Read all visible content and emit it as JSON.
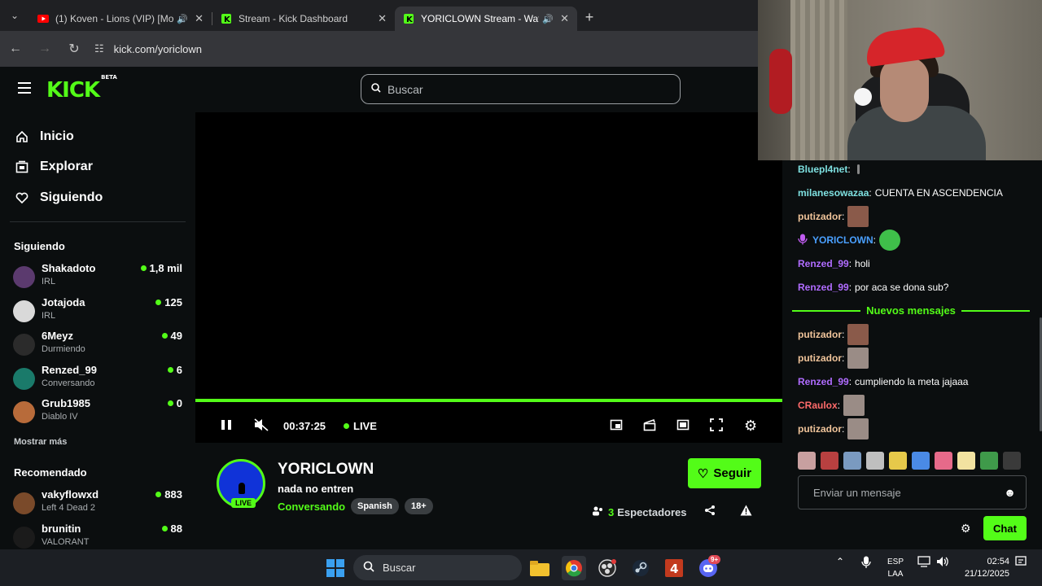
{
  "browser": {
    "tabs": [
      {
        "title": "(1) Koven - Lions (VIP) [Mon",
        "favicon": "youtube-icon",
        "speaker": "🔊",
        "close": "✕"
      },
      {
        "title": "Stream - Kick Dashboard",
        "favicon": "kick-icon",
        "close": "✕"
      },
      {
        "title": "YORICLOWN Stream - Watc",
        "favicon": "kick-icon",
        "speaker": "🔊",
        "close": "✕"
      }
    ],
    "new_tab": "+",
    "url": "kick.com/yoriclown"
  },
  "kick": {
    "logo": "KICK",
    "logo_badge": "BETA",
    "search_placeholder": "Buscar",
    "nav": [
      {
        "label": "Inicio",
        "icon": "home-icon"
      },
      {
        "label": "Explorar",
        "icon": "browse-icon"
      },
      {
        "label": "Siguiendo",
        "icon": "heart-icon"
      }
    ],
    "following_header": "Siguiendo",
    "following": [
      {
        "name": "Shakadoto",
        "category": "IRL",
        "viewers": "1,8 mil",
        "avatar_color": "#5b3a6e"
      },
      {
        "name": "Jotajoda",
        "category": "IRL",
        "viewers": "125",
        "avatar_color": "#d9d9d9"
      },
      {
        "name": "6Meyz",
        "category": "Durmiendo",
        "viewers": "49",
        "avatar_color": "#2b2b2b"
      },
      {
        "name": "Renzed_99",
        "category": "Conversando",
        "viewers": "6",
        "avatar_color": "#1a7a6a"
      },
      {
        "name": "Grub1985",
        "category": "Diablo IV",
        "viewers": "0",
        "avatar_color": "#b86b3a"
      }
    ],
    "show_more": "Mostrar más",
    "recommended_header": "Recomendado",
    "recommended": [
      {
        "name": "vakyflowxd",
        "category": "Left 4 Dead 2",
        "viewers": "883",
        "avatar_color": "#7a4a2a"
      },
      {
        "name": "brunitin",
        "category": "VALORANT",
        "viewers": "88",
        "avatar_color": "#1b1b1b"
      }
    ]
  },
  "player": {
    "time": "00:37:25",
    "live_label": "LIVE",
    "progress_fraction": 1.0
  },
  "stream": {
    "channel": "YORICLOWN",
    "title": "nada no entren",
    "category": "Conversando",
    "tags": [
      "Spanish",
      "18+"
    ],
    "live_badge": "LIVE",
    "follow_label": "Seguir",
    "viewer_count": "3",
    "viewer_label": "Espectadores"
  },
  "chat": {
    "messages": [
      {
        "user": "Bluepl4net",
        "color": "#7ee0e0",
        "text": "",
        "emote": "small-glyph"
      },
      {
        "user": "milanesowazaa",
        "color": "#7ee0e0",
        "text": "CUENTA EN ASCENDENCIA"
      },
      {
        "user": "putizador",
        "color": "#f0c49a",
        "text": "",
        "emote": "face-emote"
      },
      {
        "user": "YORICLOWN",
        "color": "#4aa0ff",
        "text": "",
        "emote": "green-emote",
        "badge": "mic-badge-icon"
      },
      {
        "user": "Renzed_99",
        "color": "#b06cff",
        "text": "holi"
      },
      {
        "user": "Renzed_99",
        "color": "#b06cff",
        "text": "por aca se dona sub?"
      }
    ],
    "new_messages_label": "Nuevos mensajes",
    "new_messages": [
      {
        "user": "putizador",
        "color": "#f0c49a",
        "text": "",
        "emote": "face-emote"
      },
      {
        "user": "putizador",
        "color": "#f0c49a",
        "text": "",
        "emote": "cat-emote"
      },
      {
        "user": "Renzed_99",
        "color": "#b06cff",
        "text": "cumpliendo la meta jajaaa"
      },
      {
        "user": "CRaulox",
        "color": "#ff6b6b",
        "text": "",
        "emote": "cat-emote"
      },
      {
        "user": "putizador",
        "color": "#f0c49a",
        "text": "",
        "emote": "cat-emote"
      }
    ],
    "input_placeholder": "Enviar un mensaje",
    "send_label": "Chat"
  },
  "taskbar": {
    "search_label": "Buscar",
    "lang_top": "ESP",
    "lang_bottom": "LAA",
    "time": "02:54",
    "date": "21/12/2025",
    "discord_badge": "9+"
  }
}
